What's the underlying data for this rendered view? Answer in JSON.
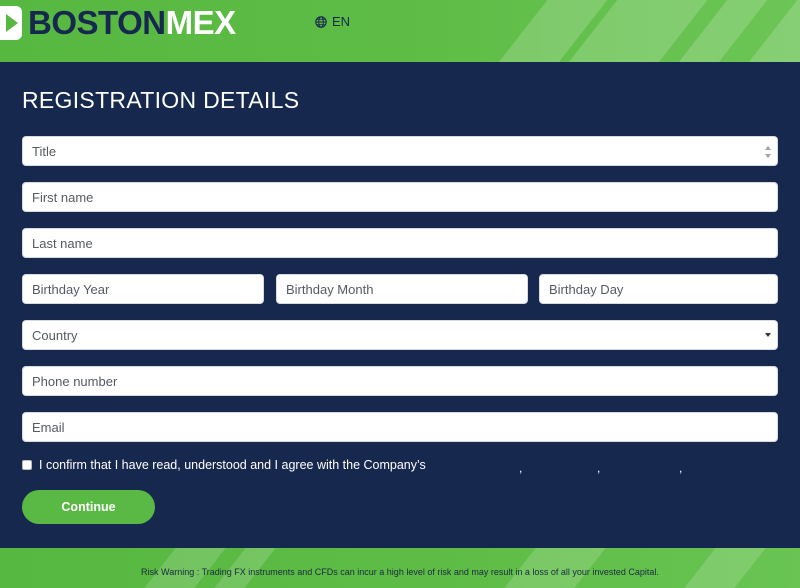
{
  "brand": {
    "part1": "BOSTON",
    "part2": "MEX"
  },
  "language": {
    "code": "EN",
    "icon": "globe-icon"
  },
  "form": {
    "title": "REGISTRATION DETAILS",
    "title_select": "Title",
    "first_name_placeholder": "First name",
    "last_name_placeholder": "Last name",
    "birthday_year_placeholder": "Birthday Year",
    "birthday_month_placeholder": "Birthday Month",
    "birthday_day_placeholder": "Birthday Day",
    "country_select": "Country",
    "phone_placeholder": "Phone number",
    "email_placeholder": "Email",
    "consent_text": "I confirm that I have read, understood and I agree with the Company’s",
    "consent_separators": [
      ",",
      ",",
      ","
    ],
    "continue_label": "Continue"
  },
  "footer": {
    "risk_warning": "Risk Warning : Trading FX instruments and CFDs can incur a high level of risk and may result in a loss of all your invested Capital."
  },
  "colors": {
    "brand_green": "#5ab845",
    "navy": "#17284f",
    "white": "#ffffff"
  }
}
